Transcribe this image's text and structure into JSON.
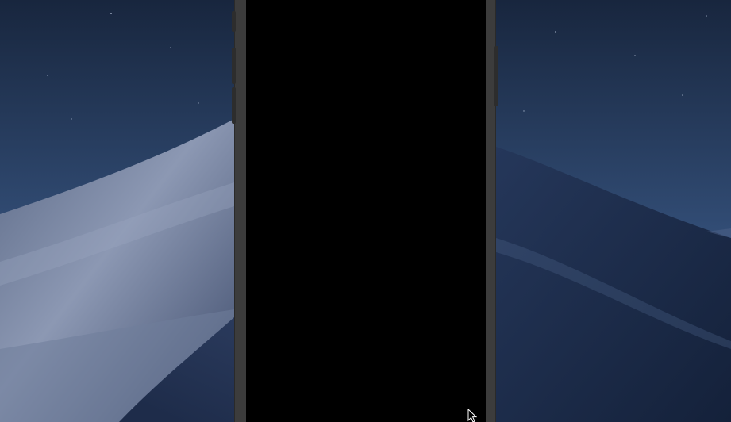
{
  "desktop": {
    "wallpaper_icon": "mojave-dunes-night-wallpaper"
  },
  "simulator": {
    "screen_state": "blank",
    "screen_color": "#000000",
    "frame_color": "#3c3c3c"
  },
  "cursor": {
    "icon": "arrow-pointer-icon"
  },
  "colors": {
    "sky_top": "#1a2a44",
    "sky_bottom": "#3d5780",
    "dune_light": "#7b8aa8",
    "dune_dark": "#1b2a48"
  }
}
